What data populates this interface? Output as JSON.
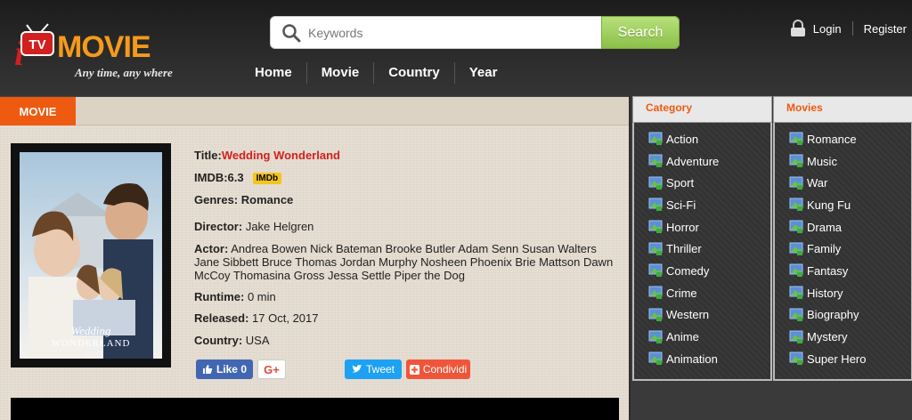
{
  "brand": {
    "name": "MOVIE",
    "tv_text": "TV",
    "i_letter": "i",
    "tagline": "Any time, any where"
  },
  "search": {
    "placeholder": "Keywords",
    "button": "Search"
  },
  "nav": [
    {
      "label": "Home"
    },
    {
      "label": "Movie"
    },
    {
      "label": "Country"
    },
    {
      "label": "Year"
    }
  ],
  "user": {
    "login": "Login",
    "register": "Register"
  },
  "tab": {
    "label": "MOVIE"
  },
  "movie": {
    "title_label": "Title:",
    "title": "Wedding Wonderland",
    "imdb_label": "IMDB:",
    "imdb_value": "6.3",
    "imdb_badge": "IMDb",
    "genres_label": "Genres:",
    "genres": "Romance",
    "director_label": "Director:",
    "director": "Jake Helgren",
    "actor_label": "Actor:",
    "actors": "Andrea Bowen Nick Bateman Brooke Butler Adam Senn Susan Walters Jane Sibbett Bruce Thomas Jordan Murphy Nosheen Phoenix Brie Mattson Dawn McCoy Thomasina Gross Jessa Settle Piper the Dog",
    "runtime_label": "Runtime:",
    "runtime": "0 min",
    "released_label": "Released:",
    "released": "17 Oct, 2017",
    "country_label": "Country:",
    "country": "USA",
    "poster_title_1": "Wedding",
    "poster_title_2": "WONDERLAND"
  },
  "social": {
    "like": "Like",
    "like_count": "0",
    "gplus": "G+",
    "tweet": "Tweet",
    "share": "Condividi"
  },
  "sidebar": {
    "category_title": "Category",
    "movies_title": "Movies",
    "categories": [
      "Action",
      "Adventure",
      "Sport",
      "Sci-Fi",
      "Horror",
      "Thriller",
      "Comedy",
      "Crime",
      "Western",
      "Anime",
      "Animation"
    ],
    "movies": [
      "Romance",
      "Music",
      "War",
      "Kung Fu",
      "Drama",
      "Family",
      "Fantasy",
      "History",
      "Biography",
      "Mystery",
      "Super Hero"
    ]
  },
  "colors": {
    "accent": "#ee5a0f",
    "title_red": "#d21f1f",
    "search_green": "#8cc04a"
  }
}
